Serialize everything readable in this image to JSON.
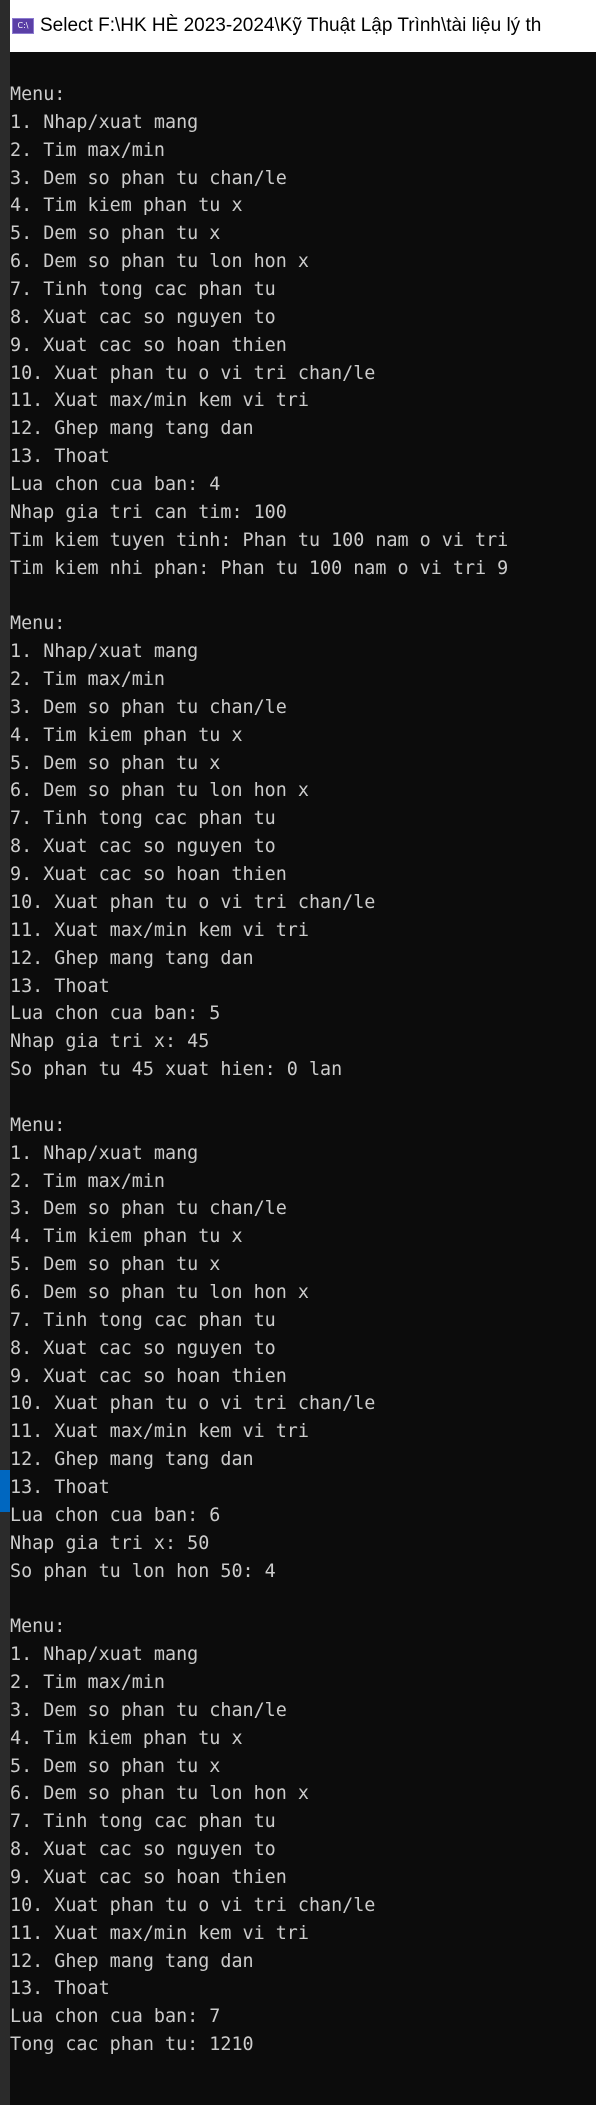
{
  "window": {
    "title": "Select F:\\HK HÈ 2023-2024\\Kỹ Thuật Lập Trình\\tài liệu lý th",
    "icon": "console-app-icon",
    "icon_label": "C:\\"
  },
  "console": {
    "lines": [
      "Menu:",
      "1. Nhap/xuat mang",
      "2. Tim max/min",
      "3. Dem so phan tu chan/le",
      "4. Tim kiem phan tu x",
      "5. Dem so phan tu x",
      "6. Dem so phan tu lon hon x",
      "7. Tinh tong cac phan tu",
      "8. Xuat cac so nguyen to",
      "9. Xuat cac so hoan thien",
      "10. Xuat phan tu o vi tri chan/le",
      "11. Xuat max/min kem vi tri",
      "12. Ghep mang tang dan",
      "13. Thoat",
      "Lua chon cua ban: 4",
      "Nhap gia tri can tim: 100",
      "Tim kiem tuyen tinh: Phan tu 100 nam o vi tri",
      "Tim kiem nhi phan: Phan tu 100 nam o vi tri 9",
      "",
      "Menu:",
      "1. Nhap/xuat mang",
      "2. Tim max/min",
      "3. Dem so phan tu chan/le",
      "4. Tim kiem phan tu x",
      "5. Dem so phan tu x",
      "6. Dem so phan tu lon hon x",
      "7. Tinh tong cac phan tu",
      "8. Xuat cac so nguyen to",
      "9. Xuat cac so hoan thien",
      "10. Xuat phan tu o vi tri chan/le",
      "11. Xuat max/min kem vi tri",
      "12. Ghep mang tang dan",
      "13. Thoat",
      "Lua chon cua ban: 5",
      "Nhap gia tri x: 45",
      "So phan tu 45 xuat hien: 0 lan",
      "",
      "Menu:",
      "1. Nhap/xuat mang",
      "2. Tim max/min",
      "3. Dem so phan tu chan/le",
      "4. Tim kiem phan tu x",
      "5. Dem so phan tu x",
      "6. Dem so phan tu lon hon x",
      "7. Tinh tong cac phan tu",
      "8. Xuat cac so nguyen to",
      "9. Xuat cac so hoan thien",
      "10. Xuat phan tu o vi tri chan/le",
      "11. Xuat max/min kem vi tri",
      "12. Ghep mang tang dan",
      "13. Thoat",
      "Lua chon cua ban: 6",
      "Nhap gia tri x: 50",
      "So phan tu lon hon 50: 4",
      "",
      "Menu:",
      "1. Nhap/xuat mang",
      "2. Tim max/min",
      "3. Dem so phan tu chan/le",
      "4. Tim kiem phan tu x",
      "5. Dem so phan tu x",
      "6. Dem so phan tu lon hon x",
      "7. Tinh tong cac phan tu",
      "8. Xuat cac so nguyen to",
      "9. Xuat cac so hoan thien",
      "10. Xuat phan tu o vi tri chan/le",
      "11. Xuat max/min kem vi tri",
      "12. Ghep mang tang dan",
      "13. Thoat",
      "Lua chon cua ban: 7",
      "Tong cac phan tu: 1210"
    ]
  },
  "colors": {
    "console_bg": "#0c0c0c",
    "console_text": "#cccccc",
    "accent": "#0067c0"
  }
}
